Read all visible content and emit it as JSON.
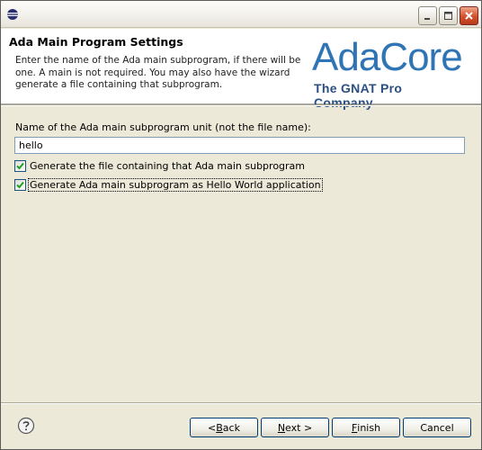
{
  "dialog": {
    "title": "Ada Main Program Settings",
    "description": "Enter the name of the Ada main subprogram, if there will be one. A main is not required. You may also have the wizard generate a file containing that subprogram.",
    "logo": {
      "word": "AdaCore",
      "tagline": "The GNAT Pro Company",
      "color": "#2f74b5"
    }
  },
  "form": {
    "name_label": "Name of the Ada main subprogram unit (not the file name):",
    "name_value": "hello",
    "checkbox_generate_file": {
      "label": "Generate the file containing that Ada main subprogram",
      "checked": true
    },
    "checkbox_hello_world": {
      "label": "Generate Ada main subprogram as Hello World application",
      "checked": true
    }
  },
  "buttons": {
    "back": {
      "pre": "< ",
      "mnemonic": "B",
      "post": "ack"
    },
    "next": {
      "mnemonic": "N",
      "post": "ext >"
    },
    "finish": {
      "mnemonic": "F",
      "post": "inish"
    },
    "cancel": "Cancel"
  },
  "icons": {
    "app": "eclipse-icon",
    "help": "help-icon",
    "minimize": "minimize-icon",
    "maximize": "maximize-icon",
    "close": "close-icon"
  }
}
